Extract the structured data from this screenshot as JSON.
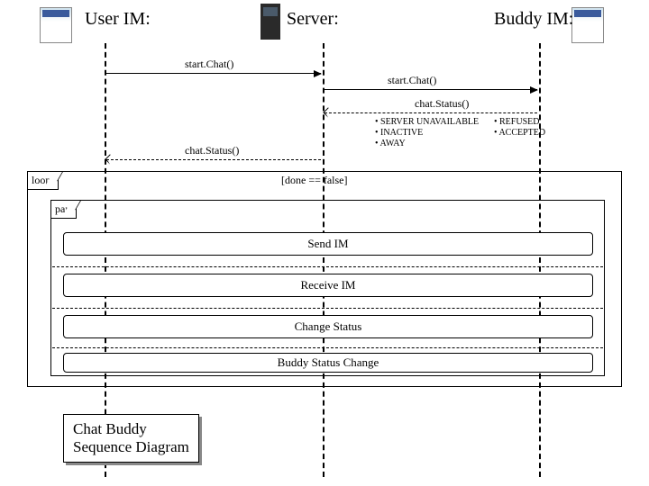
{
  "actors": {
    "user": "User IM:",
    "server": "Server:",
    "buddy": "Buddy  IM:"
  },
  "messages": {
    "startChat1": "start.Chat()",
    "startChat2": "start.Chat()",
    "chatStatus1": "chat.Status()",
    "chatStatus2": "chat.Status()"
  },
  "statuses": {
    "col1": [
      "SERVER UNAVAILABLE",
      "INACTIVE",
      "AWAY"
    ],
    "col2": [
      "REFUSED",
      "ACCEPTED"
    ]
  },
  "frames": {
    "loop": "loop",
    "par": "par"
  },
  "guard": "[done == false]",
  "interactionUses": {
    "sendIM": "Send IM",
    "receiveIM": "Receive IM",
    "changeStatus": "Change Status",
    "buddyStatus": "Buddy Status Change"
  },
  "title": "Chat  Buddy\nSequence Diagram",
  "chart_data": {
    "type": "sequence-diagram",
    "lifelines": [
      "User IM",
      "Server",
      "Buddy IM"
    ],
    "messages": [
      {
        "from": "User IM",
        "to": "Server",
        "label": "start.Chat()",
        "type": "sync"
      },
      {
        "from": "Server",
        "to": "Buddy IM",
        "label": "start.Chat()",
        "type": "sync"
      },
      {
        "from": "Buddy IM",
        "to": "Server",
        "label": "chat.Status()",
        "type": "return",
        "notes": [
          "SERVER UNAVAILABLE",
          "INACTIVE",
          "AWAY",
          "REFUSED",
          "ACCEPTED"
        ]
      },
      {
        "from": "Server",
        "to": "User IM",
        "label": "chat.Status()",
        "type": "return"
      }
    ],
    "fragments": [
      {
        "type": "loop",
        "guard": "[done == false]",
        "contains": [
          {
            "type": "par",
            "refs": [
              "Send IM",
              "Receive IM",
              "Change Status",
              "Buddy Status Change"
            ]
          }
        ]
      }
    ],
    "title": "Chat Buddy Sequence Diagram"
  }
}
